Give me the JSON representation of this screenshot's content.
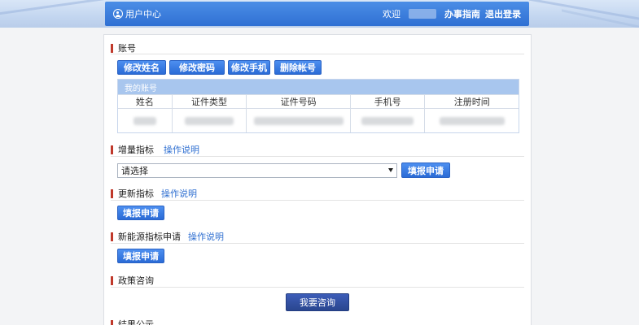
{
  "header": {
    "title": "用户中心",
    "welcome": "欢迎",
    "guide_link": "办事指南",
    "logout_link": "退出登录"
  },
  "account": {
    "section_title": "账号",
    "buttons": [
      "修改姓名",
      "修改密码",
      "修改手机",
      "删除帐号"
    ],
    "table_caption": "我的账号",
    "columns": [
      "姓名",
      "证件类型",
      "证件号码",
      "手机号",
      "注册时间"
    ]
  },
  "increment": {
    "section_title": "增量指标",
    "help_link": "操作说明",
    "select_value": "请选择",
    "submit_button": "填报申请"
  },
  "update": {
    "section_title": "更新指标",
    "help_link": "操作说明",
    "submit_button": "填报申请"
  },
  "new_energy": {
    "section_title": "新能源指标申请",
    "help_link": "操作说明",
    "submit_button": "填报申请"
  },
  "policy": {
    "section_title": "政策咨询",
    "consult_button": "我要咨询"
  },
  "results": {
    "section_title": "结果公示"
  },
  "colors": {
    "primary_blue": "#2f70d3",
    "section_bar_red": "#c0392b",
    "link_blue": "#2f6fd1"
  }
}
